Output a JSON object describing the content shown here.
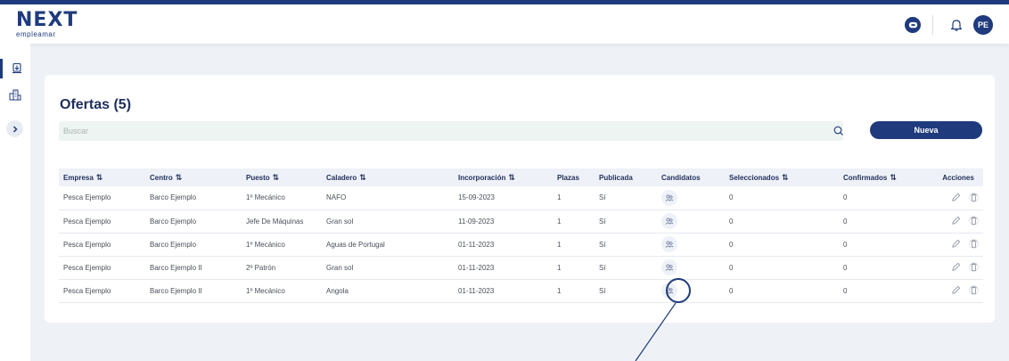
{
  "header": {
    "logo_main": "NEXT",
    "logo_sub": "empleamar",
    "user_initials": "PE"
  },
  "page": {
    "title": "Ofertas (5)",
    "search_placeholder": "Buscar",
    "new_button": "Nueva"
  },
  "table": {
    "columns": {
      "empresa": "Empresa",
      "centro": "Centro",
      "puesto": "Puesto",
      "caladero": "Caladero",
      "incorporacion": "Incorporación",
      "plazas": "Plazas",
      "publicada": "Publicada",
      "candidatos": "Candidatos",
      "seleccionados": "Seleccionados",
      "confirmados": "Confirmados",
      "acciones": "Acciones"
    },
    "rows": [
      {
        "empresa": "Pesca Ejemplo",
        "centro": "Barco Ejemplo",
        "puesto": "1º Mecánico",
        "caladero": "NAFO",
        "incorporacion": "15-09-2023",
        "plazas": "1",
        "publicada": "Sí",
        "seleccionados": "0",
        "confirmados": "0"
      },
      {
        "empresa": "Pesca Ejemplo",
        "centro": "Barco Ejemplo",
        "puesto": "Jefe De Máquinas",
        "caladero": "Gran sol",
        "incorporacion": "11-09-2023",
        "plazas": "1",
        "publicada": "Sí",
        "seleccionados": "0",
        "confirmados": "0"
      },
      {
        "empresa": "Pesca Ejemplo",
        "centro": "Barco Ejemplo",
        "puesto": "1º Mecánico",
        "caladero": "Aguas de Portugal",
        "incorporacion": "01-11-2023",
        "plazas": "1",
        "publicada": "Sí",
        "seleccionados": "0",
        "confirmados": "0"
      },
      {
        "empresa": "Pesca Ejemplo",
        "centro": "Barco Ejemplo II",
        "puesto": "2º Patrón",
        "caladero": "Gran sol",
        "incorporacion": "01-11-2023",
        "plazas": "1",
        "publicada": "Sí",
        "seleccionados": "0",
        "confirmados": "0"
      },
      {
        "empresa": "Pesca Ejemplo",
        "centro": "Barco Ejemplo II",
        "puesto": "1º Mecánico",
        "caladero": "Angola",
        "incorporacion": "01-11-2023",
        "plazas": "1",
        "publicada": "Sí",
        "seleccionados": "0",
        "confirmados": "0"
      }
    ]
  },
  "icons": {
    "chat": "chat-icon",
    "bell": "bell-icon",
    "sidebar_offers": "offers-icon",
    "sidebar_companies": "buildings-icon",
    "expand": "chevron-right-icon",
    "search": "search-icon",
    "sort": "sort-arrows-icon",
    "candidates": "users-icon",
    "edit": "pencil-icon",
    "delete": "trash-icon"
  },
  "colors": {
    "brand": "#1f3b7d",
    "page_bg": "#eef1f6",
    "search_bg": "#eef4f2"
  }
}
